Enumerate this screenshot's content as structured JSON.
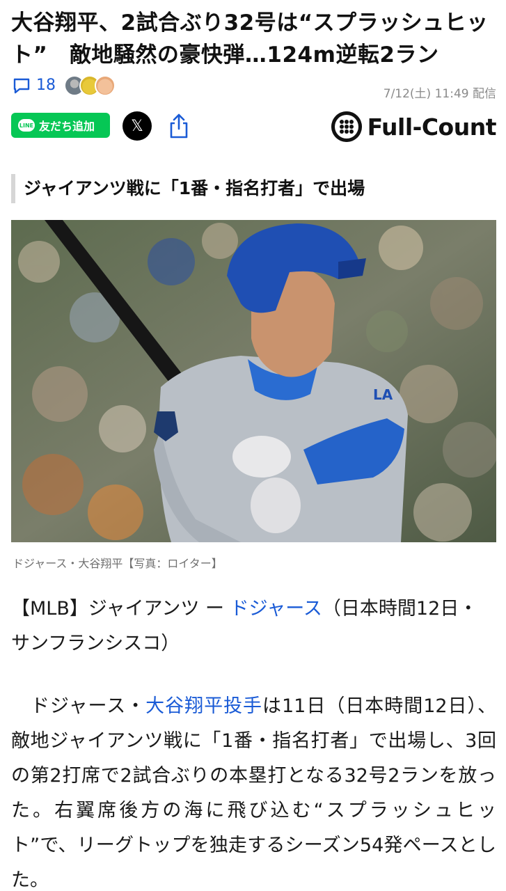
{
  "article": {
    "headline": "大谷翔平、2試合ぶり32号は“スプラッシュヒット”　敵地騒然の豪快弾…124m逆転2ラン",
    "comment_count": "18",
    "published": "7/12(土) 11:49 配信",
    "section_heading": "ジャイアンツ戦に「1番・指名打者」で出場",
    "photo_caption": "ドジャース・大谷翔平【写真：ロイター】",
    "lead": {
      "prefix": "【MLB】ジャイアンツ ー ",
      "link": "ドジャース",
      "suffix": "（日本時間12日・サンフランシスコ）"
    },
    "body": {
      "prefix": "　ドジャース・",
      "link": "大谷翔平投手",
      "suffix": "は11日（日本時間12日）、敵地ジャイアンツ戦に「1番・指名打者」で出場し、3回の第2打席で2試合ぶりの本塁打となる32号2ランを放った。右翼席後方の海に飛び込む“スプラッシュヒット”で、リーグトップを独走するシーズン54発ペースとした。"
    }
  },
  "share": {
    "line_label": "友だち追加",
    "line_logo": "LINE",
    "x_label": "𝕏"
  },
  "brand": {
    "name": "Full-Count"
  },
  "colors": {
    "link": "#1a5bd6",
    "line_green": "#06c755",
    "helmet_blue": "#1f4fb3"
  },
  "icons": [
    "comment-icon",
    "share-icon",
    "x-logo-icon",
    "line-logo-icon",
    "full-count-logo-icon"
  ]
}
